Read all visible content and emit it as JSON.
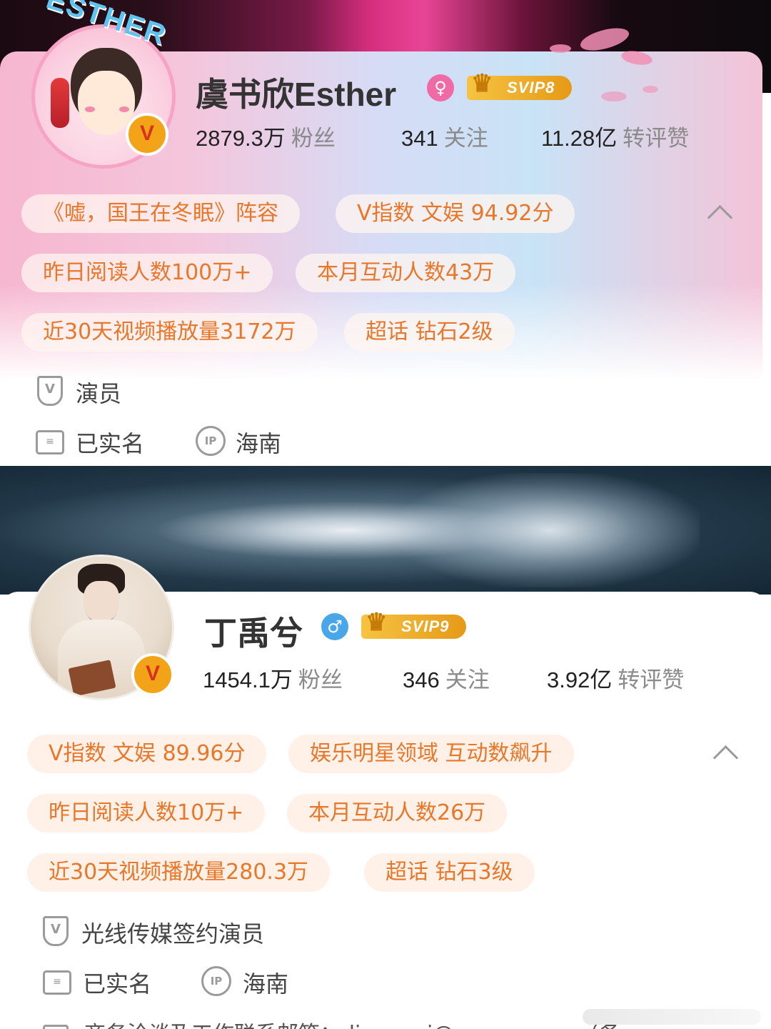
{
  "profiles": [
    {
      "name": "虞书欣Esther",
      "avatar_text": "ESTHER",
      "gender_icon": "female-icon",
      "svip": "SVIP8",
      "stats": [
        {
          "value": "2879.3万",
          "label": "粉丝"
        },
        {
          "value": "341",
          "label": "关注"
        },
        {
          "value": "11.28亿",
          "label": "转评赞"
        }
      ],
      "tags": [
        "《嘘，国王在冬眠》阵容",
        "V指数 文娱 94.92分",
        "昨日阅读人数100万+",
        "本月互动人数43万",
        "近30天视频播放量3172万",
        "超话 钻石2级"
      ],
      "verified_title": "演员",
      "real_name": "已实名",
      "ip_location": "海南"
    },
    {
      "name": "丁禹兮",
      "gender_icon": "male-icon",
      "svip": "SVIP9",
      "stats": [
        {
          "value": "1454.1万",
          "label": "粉丝"
        },
        {
          "value": "346",
          "label": "关注"
        },
        {
          "value": "3.92亿",
          "label": "转评赞"
        }
      ],
      "tags": [
        "V指数 文娱 89.96分",
        "娱乐明星领域 互动数飙升",
        "昨日阅读人数10万+",
        "本月互动人数26万",
        "近30天视频播放量280.3万",
        "超话 钻石3级"
      ],
      "verified_title": "光线传媒签约演员",
      "real_name": "已实名",
      "ip_location": "海南",
      "contact_partial": "商务洽谈及工作联系邮箱：dingyuxi@ewang.com（备"
    }
  ],
  "icons": {
    "verified_badge": "V",
    "ip_badge": "IP",
    "female": "♀",
    "male": "♂",
    "crown": "♛"
  },
  "colors": {
    "tag_text": "#e8772a",
    "svip_gold": "#e59a17",
    "female_pink": "#f06aa6",
    "male_blue": "#49a6e8"
  }
}
